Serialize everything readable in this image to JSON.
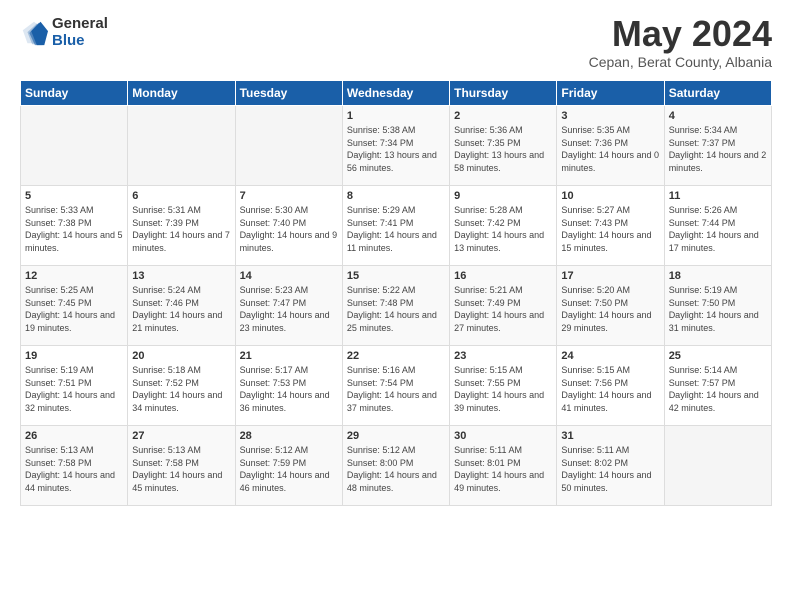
{
  "logo": {
    "general": "General",
    "blue": "Blue"
  },
  "title": "May 2024",
  "location": "Cepan, Berat County, Albania",
  "days_of_week": [
    "Sunday",
    "Monday",
    "Tuesday",
    "Wednesday",
    "Thursday",
    "Friday",
    "Saturday"
  ],
  "weeks": [
    [
      {
        "day": "",
        "sunrise": "",
        "sunset": "",
        "daylight": ""
      },
      {
        "day": "",
        "sunrise": "",
        "sunset": "",
        "daylight": ""
      },
      {
        "day": "",
        "sunrise": "",
        "sunset": "",
        "daylight": ""
      },
      {
        "day": "1",
        "sunrise": "Sunrise: 5:38 AM",
        "sunset": "Sunset: 7:34 PM",
        "daylight": "Daylight: 13 hours and 56 minutes."
      },
      {
        "day": "2",
        "sunrise": "Sunrise: 5:36 AM",
        "sunset": "Sunset: 7:35 PM",
        "daylight": "Daylight: 13 hours and 58 minutes."
      },
      {
        "day": "3",
        "sunrise": "Sunrise: 5:35 AM",
        "sunset": "Sunset: 7:36 PM",
        "daylight": "Daylight: 14 hours and 0 minutes."
      },
      {
        "day": "4",
        "sunrise": "Sunrise: 5:34 AM",
        "sunset": "Sunset: 7:37 PM",
        "daylight": "Daylight: 14 hours and 2 minutes."
      }
    ],
    [
      {
        "day": "5",
        "sunrise": "Sunrise: 5:33 AM",
        "sunset": "Sunset: 7:38 PM",
        "daylight": "Daylight: 14 hours and 5 minutes."
      },
      {
        "day": "6",
        "sunrise": "Sunrise: 5:31 AM",
        "sunset": "Sunset: 7:39 PM",
        "daylight": "Daylight: 14 hours and 7 minutes."
      },
      {
        "day": "7",
        "sunrise": "Sunrise: 5:30 AM",
        "sunset": "Sunset: 7:40 PM",
        "daylight": "Daylight: 14 hours and 9 minutes."
      },
      {
        "day": "8",
        "sunrise": "Sunrise: 5:29 AM",
        "sunset": "Sunset: 7:41 PM",
        "daylight": "Daylight: 14 hours and 11 minutes."
      },
      {
        "day": "9",
        "sunrise": "Sunrise: 5:28 AM",
        "sunset": "Sunset: 7:42 PM",
        "daylight": "Daylight: 14 hours and 13 minutes."
      },
      {
        "day": "10",
        "sunrise": "Sunrise: 5:27 AM",
        "sunset": "Sunset: 7:43 PM",
        "daylight": "Daylight: 14 hours and 15 minutes."
      },
      {
        "day": "11",
        "sunrise": "Sunrise: 5:26 AM",
        "sunset": "Sunset: 7:44 PM",
        "daylight": "Daylight: 14 hours and 17 minutes."
      }
    ],
    [
      {
        "day": "12",
        "sunrise": "Sunrise: 5:25 AM",
        "sunset": "Sunset: 7:45 PM",
        "daylight": "Daylight: 14 hours and 19 minutes."
      },
      {
        "day": "13",
        "sunrise": "Sunrise: 5:24 AM",
        "sunset": "Sunset: 7:46 PM",
        "daylight": "Daylight: 14 hours and 21 minutes."
      },
      {
        "day": "14",
        "sunrise": "Sunrise: 5:23 AM",
        "sunset": "Sunset: 7:47 PM",
        "daylight": "Daylight: 14 hours and 23 minutes."
      },
      {
        "day": "15",
        "sunrise": "Sunrise: 5:22 AM",
        "sunset": "Sunset: 7:48 PM",
        "daylight": "Daylight: 14 hours and 25 minutes."
      },
      {
        "day": "16",
        "sunrise": "Sunrise: 5:21 AM",
        "sunset": "Sunset: 7:49 PM",
        "daylight": "Daylight: 14 hours and 27 minutes."
      },
      {
        "day": "17",
        "sunrise": "Sunrise: 5:20 AM",
        "sunset": "Sunset: 7:50 PM",
        "daylight": "Daylight: 14 hours and 29 minutes."
      },
      {
        "day": "18",
        "sunrise": "Sunrise: 5:19 AM",
        "sunset": "Sunset: 7:50 PM",
        "daylight": "Daylight: 14 hours and 31 minutes."
      }
    ],
    [
      {
        "day": "19",
        "sunrise": "Sunrise: 5:19 AM",
        "sunset": "Sunset: 7:51 PM",
        "daylight": "Daylight: 14 hours and 32 minutes."
      },
      {
        "day": "20",
        "sunrise": "Sunrise: 5:18 AM",
        "sunset": "Sunset: 7:52 PM",
        "daylight": "Daylight: 14 hours and 34 minutes."
      },
      {
        "day": "21",
        "sunrise": "Sunrise: 5:17 AM",
        "sunset": "Sunset: 7:53 PM",
        "daylight": "Daylight: 14 hours and 36 minutes."
      },
      {
        "day": "22",
        "sunrise": "Sunrise: 5:16 AM",
        "sunset": "Sunset: 7:54 PM",
        "daylight": "Daylight: 14 hours and 37 minutes."
      },
      {
        "day": "23",
        "sunrise": "Sunrise: 5:15 AM",
        "sunset": "Sunset: 7:55 PM",
        "daylight": "Daylight: 14 hours and 39 minutes."
      },
      {
        "day": "24",
        "sunrise": "Sunrise: 5:15 AM",
        "sunset": "Sunset: 7:56 PM",
        "daylight": "Daylight: 14 hours and 41 minutes."
      },
      {
        "day": "25",
        "sunrise": "Sunrise: 5:14 AM",
        "sunset": "Sunset: 7:57 PM",
        "daylight": "Daylight: 14 hours and 42 minutes."
      }
    ],
    [
      {
        "day": "26",
        "sunrise": "Sunrise: 5:13 AM",
        "sunset": "Sunset: 7:58 PM",
        "daylight": "Daylight: 14 hours and 44 minutes."
      },
      {
        "day": "27",
        "sunrise": "Sunrise: 5:13 AM",
        "sunset": "Sunset: 7:58 PM",
        "daylight": "Daylight: 14 hours and 45 minutes."
      },
      {
        "day": "28",
        "sunrise": "Sunrise: 5:12 AM",
        "sunset": "Sunset: 7:59 PM",
        "daylight": "Daylight: 14 hours and 46 minutes."
      },
      {
        "day": "29",
        "sunrise": "Sunrise: 5:12 AM",
        "sunset": "Sunset: 8:00 PM",
        "daylight": "Daylight: 14 hours and 48 minutes."
      },
      {
        "day": "30",
        "sunrise": "Sunrise: 5:11 AM",
        "sunset": "Sunset: 8:01 PM",
        "daylight": "Daylight: 14 hours and 49 minutes."
      },
      {
        "day": "31",
        "sunrise": "Sunrise: 5:11 AM",
        "sunset": "Sunset: 8:02 PM",
        "daylight": "Daylight: 14 hours and 50 minutes."
      },
      {
        "day": "",
        "sunrise": "",
        "sunset": "",
        "daylight": ""
      }
    ]
  ]
}
